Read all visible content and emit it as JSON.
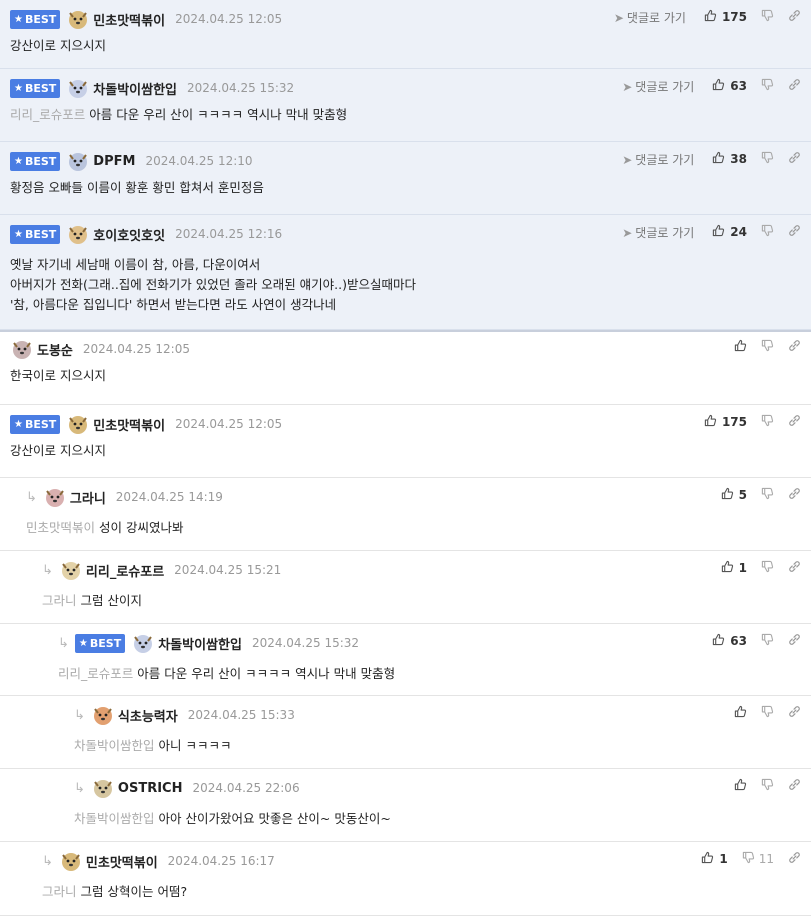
{
  "comments": [
    {
      "best": true,
      "badge": "BEST",
      "nick": "민초맛떡볶이",
      "time": "2024.04.25 12:05",
      "mention": "",
      "text": "강산이로 지으시지",
      "goto": "댓글로 가기",
      "likes": "175"
    },
    {
      "best": true,
      "badge": "BEST",
      "nick": "차돌박이쌈한입",
      "time": "2024.04.25 15:32",
      "mention": "리리_로슈포르",
      "text": "아름 다운 우리 산이 ㅋㅋㅋㅋ 역시나 막내 맞춤형",
      "goto": "댓글로 가기",
      "likes": "63"
    },
    {
      "best": true,
      "badge": "BEST",
      "nick": "DPFM",
      "time": "2024.04.25 12:10",
      "mention": "",
      "text": "황정음 오빠들 이름이 황훈 황민 합쳐서 훈민정음",
      "goto": "댓글로 가기",
      "likes": "38"
    },
    {
      "best": true,
      "badge": "BEST",
      "nick": "호이호잇호잇",
      "time": "2024.04.25 12:16",
      "mention": "",
      "lines": [
        "옛날 자기네 세남매 이름이 참, 아름, 다운이여서",
        "아버지가 전화(그래..집에 전화기가 있었던 졸라 오래된 얘기야..)받으실때마다",
        "'참, 아름다운 집입니다' 하면서 받는다면 라도 사연이 생각나네"
      ],
      "goto": "댓글로 가기",
      "likes": "24"
    },
    {
      "best": false,
      "nick": "도봉순",
      "time": "2024.04.25 12:05",
      "mention": "",
      "text": "한국이로 지으시지",
      "likes": ""
    },
    {
      "best": false,
      "badge": "BEST",
      "nick": "민초맛떡볶이",
      "time": "2024.04.25 12:05",
      "mention": "",
      "text": "강산이로 지으시지",
      "likes": "175"
    },
    {
      "best": false,
      "nick": "그라니",
      "time": "2024.04.25 14:19",
      "mention": "민초맛떡볶이",
      "text": "성이 강씨였나봐",
      "likes": "5"
    },
    {
      "best": false,
      "nick": "리리_로슈포르",
      "time": "2024.04.25 15:21",
      "mention": "그라니",
      "text": "그럼 산이지",
      "likes": "1"
    },
    {
      "best": false,
      "badge": "BEST",
      "nick": "차돌박이쌈한입",
      "time": "2024.04.25 15:32",
      "mention": "리리_로슈포르",
      "text": "아름 다운 우리 산이 ㅋㅋㅋㅋ 역시나 막내 맞춤형",
      "likes": "63"
    },
    {
      "best": false,
      "nick": "식초능력자",
      "time": "2024.04.25 15:33",
      "mention": "차돌박이쌈한입",
      "text": "아니 ㅋㅋㅋㅋ",
      "likes": ""
    },
    {
      "best": false,
      "nick": "OSTRICH",
      "time": "2024.04.25 22:06",
      "mention": "차돌박이쌈한입",
      "text": "아아 산이가왔어요 맛좋은 산이~ 맛동산이~",
      "likes": ""
    },
    {
      "best": false,
      "nick": "민초맛떡볶이",
      "time": "2024.04.25 16:17",
      "mention": "그라니",
      "text": "그럼 상혁이는 어떰?",
      "likes": "1",
      "dislikes": "11"
    }
  ],
  "reply_icon": "reply-arrow-icon",
  "colors": {
    "best_bg": "#edf1f8",
    "badge": "#4a7de3"
  }
}
